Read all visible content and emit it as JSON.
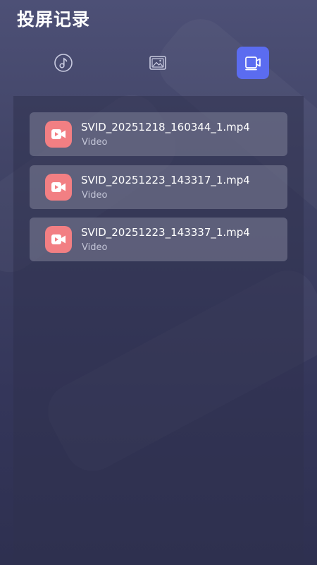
{
  "header": {
    "title": "投屏记录"
  },
  "tabs": [
    {
      "icon": "music-note-icon",
      "selected": false
    },
    {
      "icon": "image-icon",
      "selected": false
    },
    {
      "icon": "video-icon",
      "selected": true
    }
  ],
  "colors": {
    "accent": "#5b6cf0",
    "video_icon_bg": "#f27f83"
  },
  "files": [
    {
      "name": "SVID_20251218_160344_1.mp4",
      "type": "Video"
    },
    {
      "name": "SVID_20251223_143317_1.mp4",
      "type": "Video"
    },
    {
      "name": "SVID_20251223_143337_1.mp4",
      "type": "Video"
    }
  ]
}
